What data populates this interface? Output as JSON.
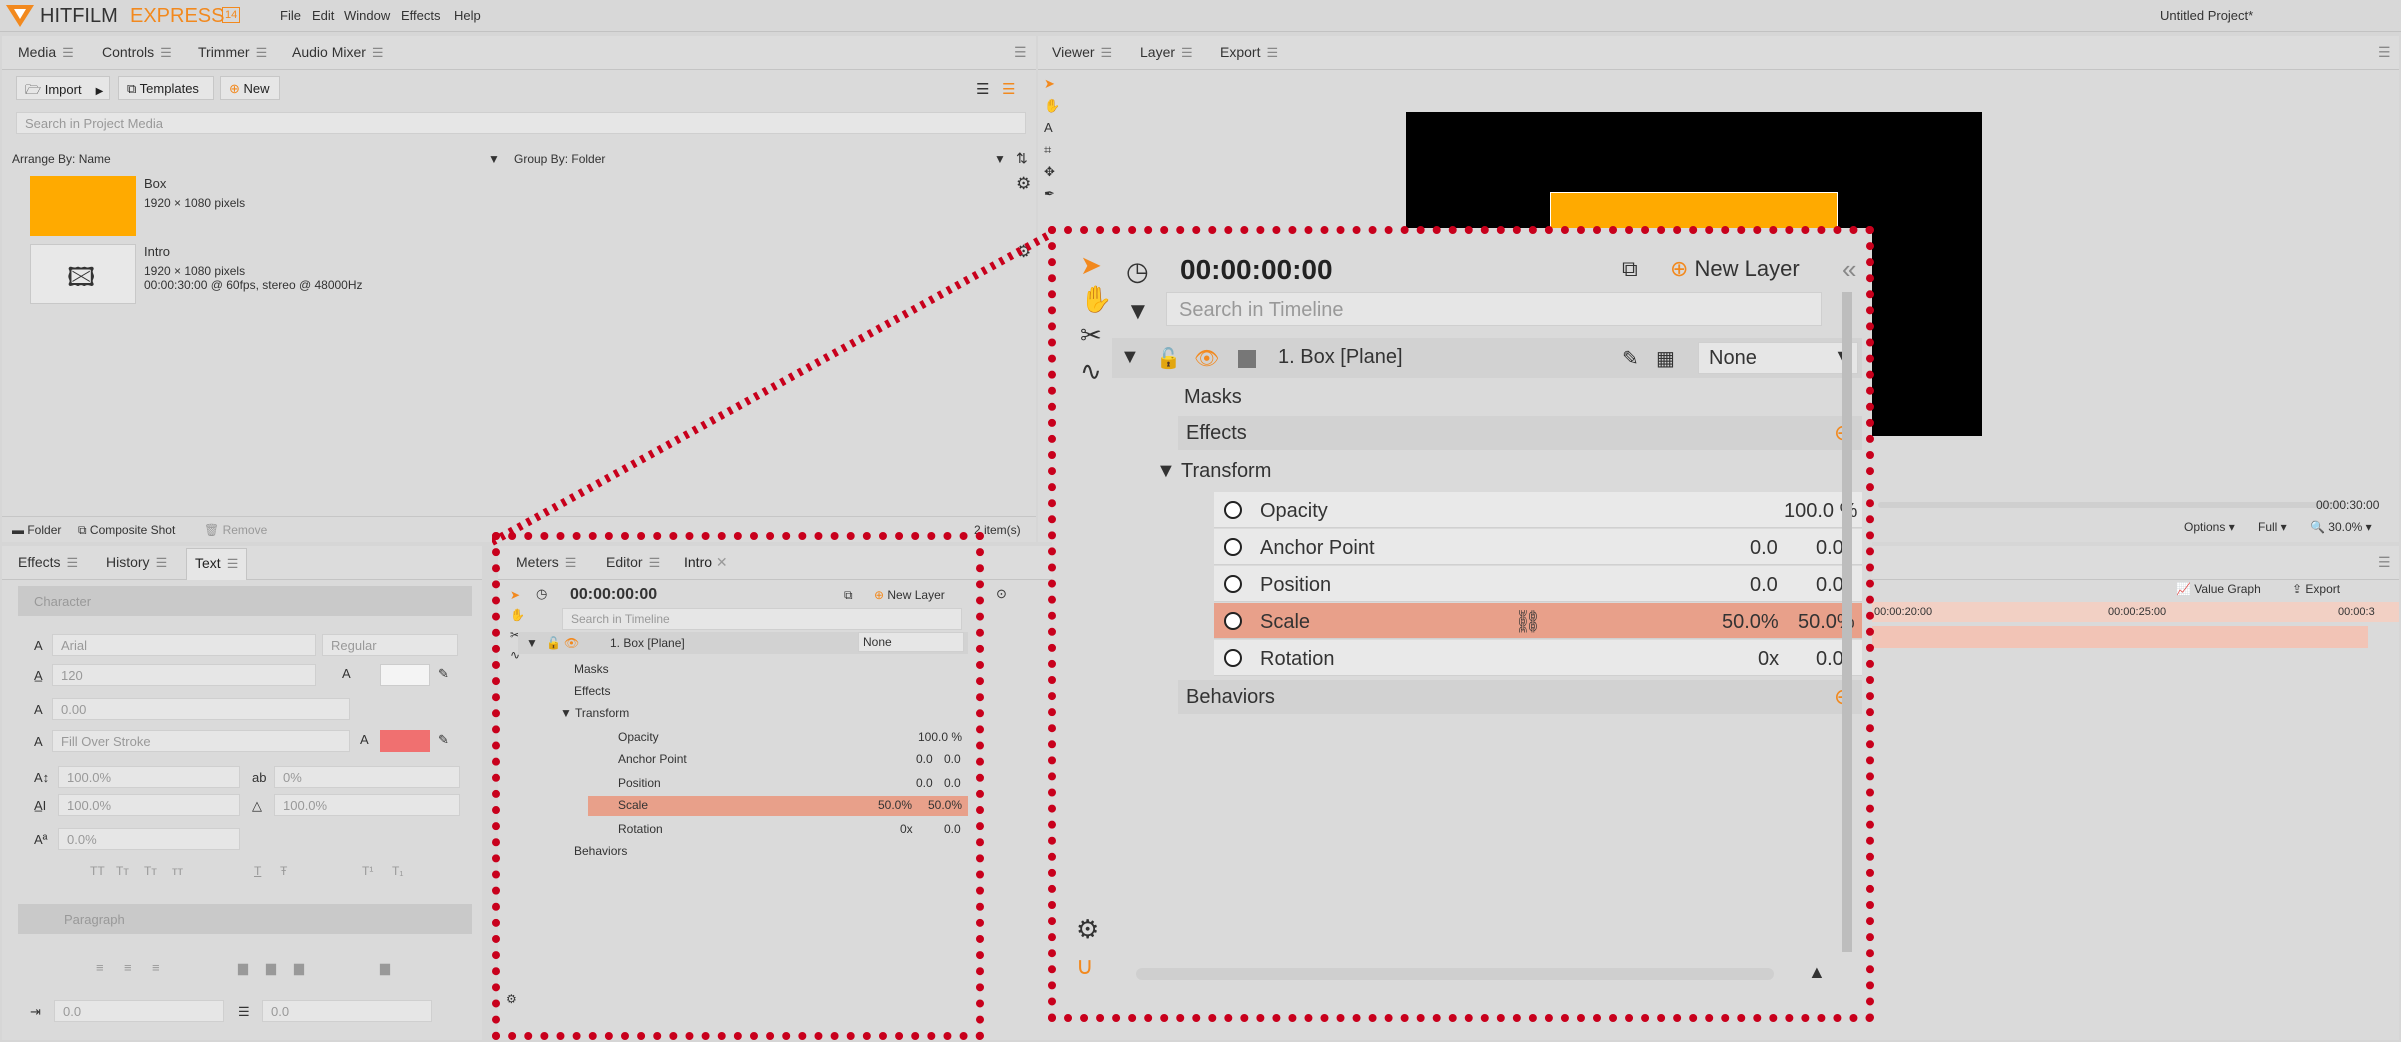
{
  "app": {
    "name": "HITFILM",
    "name2": "EXPRESS",
    "version": "14",
    "project_title": "Untitled Project*"
  },
  "menu": [
    "File",
    "Edit",
    "Window",
    "Effects",
    "Help"
  ],
  "media_panel": {
    "tabs": [
      "Media",
      "Controls",
      "Trimmer",
      "Audio Mixer"
    ],
    "import_label": "Import",
    "templates_label": "Templates",
    "new_label": "New",
    "search_placeholder": "Search in Project Media",
    "arrange_by": "Arrange By: Name",
    "group_by": "Group By: Folder",
    "items": [
      {
        "name": "Box",
        "line1": "1920 × 1080 pixels",
        "line2": ""
      },
      {
        "name": "Intro",
        "line1": "1920 × 1080 pixels",
        "line2": "00:00:30:00 @ 60fps, stereo @ 48000Hz"
      }
    ],
    "footer": {
      "folder": "Folder",
      "composite": "Composite Shot",
      "remove": "Remove",
      "count": "2 item(s)"
    }
  },
  "viewer_panel": {
    "tabs": [
      "Viewer",
      "Layer",
      "Export"
    ],
    "time_end": "00:00:30:00",
    "options": "Options",
    "full": "Full",
    "zoom": "30.0%"
  },
  "text_panel": {
    "tabs": [
      "Effects",
      "History",
      "Text"
    ],
    "character_header": "Character",
    "font": "Arial",
    "style": "Regular",
    "size": "120",
    "tracking": "0.00",
    "fill_mode": "Fill Over Stroke",
    "scale_h": "100.0%",
    "skew": "0%",
    "scale_v": "100.0%",
    "rotation": "100.0%",
    "baseline": "0.0%",
    "caps": [
      "TT",
      "Tт",
      "Tт",
      "тт",
      "T",
      "Ŧ",
      "T¹",
      "T₁"
    ],
    "paragraph_header": "Paragraph",
    "indent1": "0.0",
    "indent2": "0.0"
  },
  "timeline_panel": {
    "tabs": [
      "Meters",
      "Editor",
      "Intro"
    ],
    "time": "00:00:00:00",
    "new_layer": "New Layer",
    "search_placeholder": "Search in Timeline",
    "layer_name": "1. Box [Plane]",
    "blend": "None",
    "masks": "Masks",
    "effects": "Effects",
    "transform": "Transform",
    "behaviors": "Behaviors",
    "properties": [
      {
        "name": "Opacity",
        "v1": "",
        "v2": "100.0 %"
      },
      {
        "name": "Anchor Point",
        "v1": "0.0",
        "v2": "0.0"
      },
      {
        "name": "Position",
        "v1": "0.0",
        "v2": "0.0"
      },
      {
        "name": "Scale",
        "v1": "50.0%",
        "v2": "50.0%"
      },
      {
        "name": "Rotation",
        "v1": "0x",
        "v2": "0.0"
      }
    ],
    "ruler": [
      "00:00:20:00",
      "00:00:25:00",
      "00:00:3"
    ],
    "value_graph": "Value Graph",
    "export": "Export"
  },
  "colors": {
    "accent": "#f2891e",
    "highlight": "#e8a08a",
    "callout": "#c8001c",
    "box": "#ffaa00"
  }
}
